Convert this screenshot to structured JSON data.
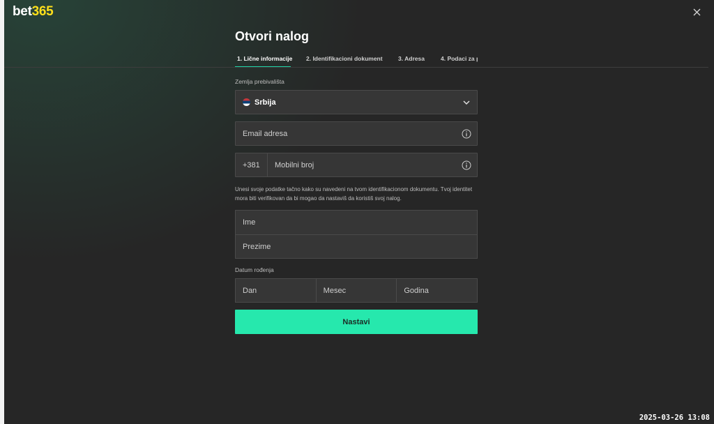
{
  "logo": {
    "part1": "bet",
    "part2": "365"
  },
  "title": "Otvori nalog",
  "tabs": [
    {
      "label": "1.  Lične informacije"
    },
    {
      "label": "2.  Identifikacioni dokument"
    },
    {
      "label": "3.  Adresa"
    },
    {
      "label": "4.  Podaci za p"
    }
  ],
  "country": {
    "label": "Zemlja prebivališta",
    "value": "Srbija"
  },
  "email": {
    "placeholder": "Email adresa"
  },
  "phone": {
    "prefix": "+381",
    "placeholder": "Mobilni broj"
  },
  "help_text": "Unesi svoje podatke tačno kako su navedeni na tvom identifikacionom dokumentu. Tvoj identitet mora biti verifikovan da bi mogao da nastaviš da koristiš svoj nalog.",
  "name": {
    "first_placeholder": "Ime",
    "last_placeholder": "Prezime"
  },
  "dob": {
    "label": "Datum rođenja",
    "day": "Dan",
    "month": "Mesec",
    "year": "Godina"
  },
  "submit_label": "Nastavi",
  "timestamp": "2025-03-26 13:08",
  "colors": {
    "accent": "#26e8ad",
    "background": "#262626",
    "logo_yellow": "#ffdf1b"
  }
}
